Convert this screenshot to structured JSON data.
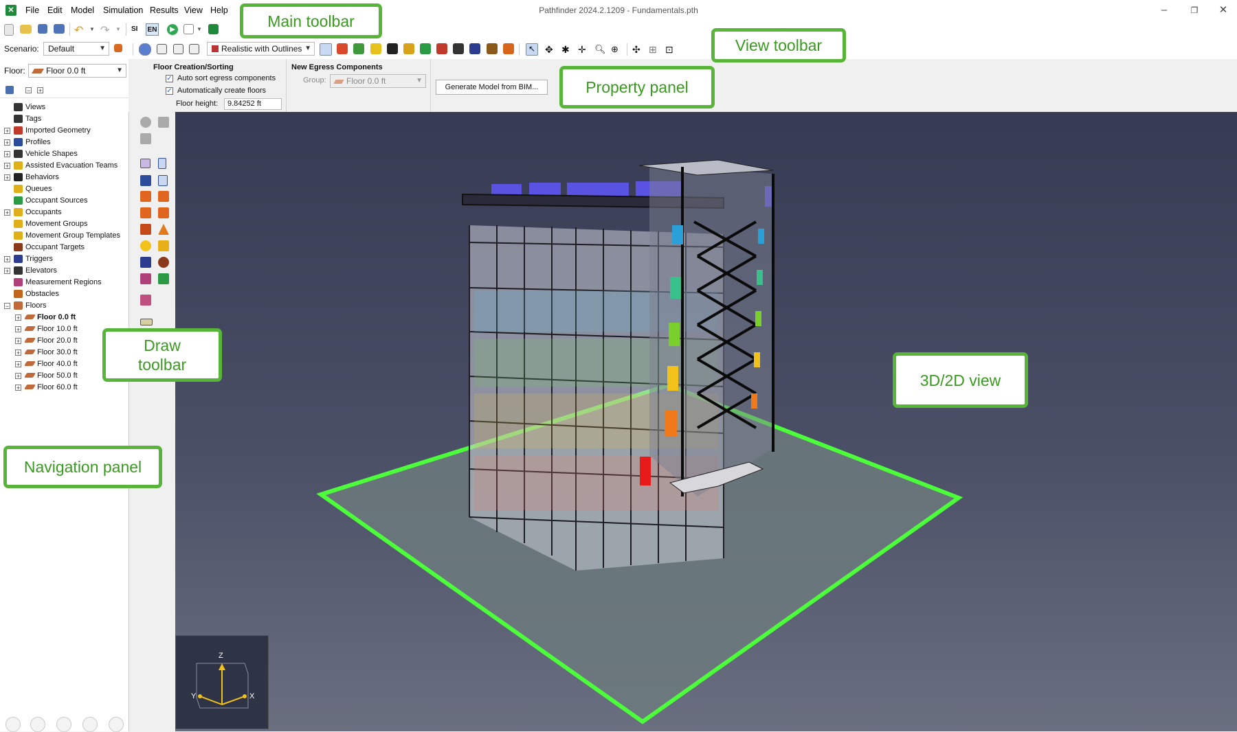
{
  "app": {
    "title": "Pathfinder 2024.2.1209 - Fundamentals.pth"
  },
  "menu": [
    "File",
    "Edit",
    "Model",
    "Simulation",
    "Results",
    "View",
    "Help"
  ],
  "main_toolbar": {
    "si_label": "SI",
    "en_label": "EN"
  },
  "scenario": {
    "label": "Scenario:",
    "value": "Default"
  },
  "render_mode": {
    "value": "Realistic with Outlines"
  },
  "floor_select": {
    "label": "Floor:",
    "value": "Floor 0.0 ft"
  },
  "navigation": {
    "items": [
      {
        "label": "Views",
        "expandable": false
      },
      {
        "label": "Tags",
        "expandable": false
      },
      {
        "label": "Imported Geometry",
        "expandable": true
      },
      {
        "label": "Profiles",
        "expandable": true
      },
      {
        "label": "Vehicle Shapes",
        "expandable": true
      },
      {
        "label": "Assisted Evacuation Teams",
        "expandable": true
      },
      {
        "label": "Behaviors",
        "expandable": true
      },
      {
        "label": "Queues",
        "expandable": false
      },
      {
        "label": "Occupant Sources",
        "expandable": false
      },
      {
        "label": "Occupants",
        "expandable": true
      },
      {
        "label": "Movement Groups",
        "expandable": false
      },
      {
        "label": "Movement Group Templates",
        "expandable": false
      },
      {
        "label": "Occupant Targets",
        "expandable": false
      },
      {
        "label": "Triggers",
        "expandable": true
      },
      {
        "label": "Elevators",
        "expandable": true
      },
      {
        "label": "Measurement Regions",
        "expandable": false
      },
      {
        "label": "Obstacles",
        "expandable": false
      },
      {
        "label": "Floors",
        "expandable": true
      }
    ],
    "floors": [
      "Floor 0.0 ft",
      "Floor 10.0 ft",
      "Floor 20.0 ft",
      "Floor 30.0 ft",
      "Floor 40.0 ft",
      "Floor 50.0 ft",
      "Floor 60.0 ft"
    ],
    "active_floor": "Floor 0.0 ft"
  },
  "property_panel": {
    "floor_creation_title": "Floor Creation/Sorting",
    "auto_sort_label": "Auto sort egress components",
    "auto_create_label": "Automatically create floors",
    "floor_height_label": "Floor height:",
    "floor_height_value": "9.84252 ft",
    "new_egress_title": "New Egress Components",
    "group_label": "Group:",
    "group_value": "Floor 0.0 ft",
    "generate_button": "Generate Model from BIM..."
  },
  "axes": {
    "z": "Z",
    "y": "Y",
    "x": "X"
  },
  "callouts": {
    "main_toolbar": "Main toolbar",
    "view_toolbar": "View toolbar",
    "property_panel": "Property panel",
    "draw_toolbar_line1": "Draw",
    "draw_toolbar_line2": "toolbar",
    "navigation_panel": "Navigation panel",
    "view_3d": "3D/2D view"
  },
  "colors": {
    "callout_border": "#59b53a",
    "floor_outline": "#4cff3a",
    "view_bg": "#3f4359"
  }
}
